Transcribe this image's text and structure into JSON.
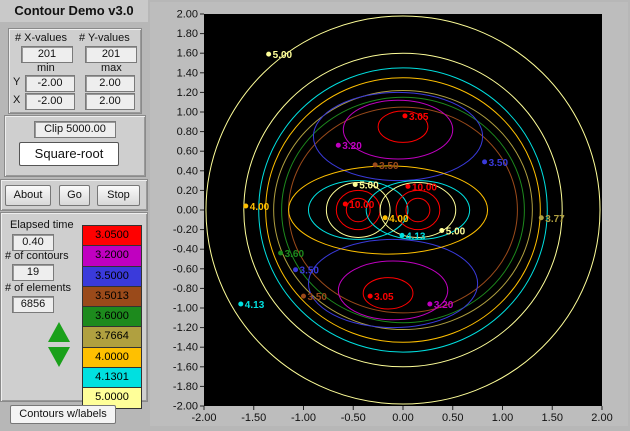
{
  "app": {
    "title": "Contour Demo v3.0"
  },
  "grid": {
    "x_values_label": "# X-values",
    "y_values_label": "# Y-values",
    "x_values": "201",
    "y_values": "201",
    "min_label": "min",
    "max_label": "max",
    "y_label": "Y",
    "x_label": "X",
    "y_min": "-2.00",
    "y_max": "2.00",
    "x_min": "-2.00",
    "x_max": "2.00"
  },
  "clip": {
    "value": "Clip 5000.00"
  },
  "transform": {
    "selected": "Square-root"
  },
  "buttons": {
    "about": "About",
    "go": "Go",
    "stop": "Stop"
  },
  "stats": {
    "elapsed_label": "Elapsed time",
    "elapsed_value": "0.40",
    "contours_label": "# of contours",
    "contours_value": "19",
    "elements_label": "# of elements",
    "elements_value": "6856"
  },
  "legend": [
    {
      "label": "3.0500",
      "color": "#ff0000"
    },
    {
      "label": "3.2000",
      "color": "#c000c0"
    },
    {
      "label": "3.5000",
      "color": "#3a3adb"
    },
    {
      "label": "3.5013",
      "color": "#9a4a1a"
    },
    {
      "label": "3.6000",
      "color": "#1d8a1d"
    },
    {
      "label": "3.7664",
      "color": "#b0a040"
    },
    {
      "label": "4.0000",
      "color": "#ffc000"
    },
    {
      "label": "4.1301",
      "color": "#00e0e0"
    },
    {
      "label": "5.0000",
      "color": "#ffff99"
    }
  ],
  "mode": {
    "selected": "Contours w/labels"
  },
  "chart_data": {
    "type": "contour",
    "x_ticks": [
      "-2.00",
      "-1.50",
      "-1.00",
      "-0.50",
      "0.00",
      "0.50",
      "1.00",
      "1.50",
      "2.00"
    ],
    "y_ticks": [
      "2.00",
      "1.80",
      "1.60",
      "1.40",
      "1.20",
      "1.00",
      "0.80",
      "0.60",
      "0.40",
      "0.20",
      "0.00",
      "-0.20",
      "-0.40",
      "-0.60",
      "-0.80",
      "-1.00",
      "-1.20",
      "-1.40",
      "-1.60",
      "-1.80",
      "-2.00"
    ],
    "xlim": [
      -2,
      2
    ],
    "ylim": [
      -2,
      2
    ],
    "contour_labels": [
      {
        "text": "5.00",
        "x": -1.32,
        "y": 1.55,
        "color": "#ffff99"
      },
      {
        "text": "3.05",
        "x": 0.05,
        "y": 0.92,
        "color": "#ff0000"
      },
      {
        "text": "3.20",
        "x": -0.62,
        "y": 0.62,
        "color": "#c000c0"
      },
      {
        "text": "3.50",
        "x": -0.25,
        "y": 0.42,
        "color": "#9a4a1a"
      },
      {
        "text": "3.50",
        "x": 0.85,
        "y": 0.45,
        "color": "#3a3adb"
      },
      {
        "text": "5.00",
        "x": -0.45,
        "y": 0.22,
        "color": "#ffff99"
      },
      {
        "text": "10.00",
        "x": -0.55,
        "y": 0.02,
        "color": "#ff0000"
      },
      {
        "text": "10.00",
        "x": 0.08,
        "y": 0.2,
        "color": "#ff0000"
      },
      {
        "text": "4.00",
        "x": -1.55,
        "y": 0.0,
        "color": "#ffc000"
      },
      {
        "text": "4.00",
        "x": -0.15,
        "y": -0.12,
        "color": "#ffc000"
      },
      {
        "text": "4.13",
        "x": 0.02,
        "y": -0.3,
        "color": "#00e0e0"
      },
      {
        "text": "5.00",
        "x": 0.42,
        "y": -0.25,
        "color": "#ffff99"
      },
      {
        "text": "3.77",
        "x": 1.42,
        "y": -0.12,
        "color": "#b0a040"
      },
      {
        "text": "3.60",
        "x": -1.2,
        "y": -0.48,
        "color": "#1d8a1d"
      },
      {
        "text": "3.50",
        "x": -1.05,
        "y": -0.65,
        "color": "#3a3adb"
      },
      {
        "text": "3.05",
        "x": -0.3,
        "y": -0.92,
        "color": "#ff0000"
      },
      {
        "text": "3.50",
        "x": -0.97,
        "y": -0.92,
        "color": "#9a4a1a"
      },
      {
        "text": "3.20",
        "x": 0.3,
        "y": -1.0,
        "color": "#c000c0"
      },
      {
        "text": "4.13",
        "x": -1.6,
        "y": -1.0,
        "color": "#00e0e0"
      }
    ]
  }
}
